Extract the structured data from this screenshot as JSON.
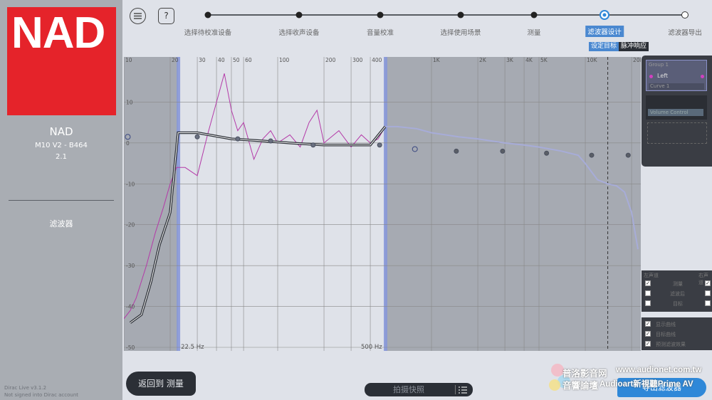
{
  "sidebar": {
    "logo_text": "NAD",
    "brand": "NAD",
    "model": "M10 V2 - B464",
    "channels": "2.1",
    "section": "滤波器",
    "version": "Dirac Live v3.1.2",
    "sign_status": "Not signed into Dirac account"
  },
  "header": {
    "menu_icon": "hamburger-icon",
    "help_label": "?"
  },
  "steps": [
    {
      "label": "选择待校准设备"
    },
    {
      "label": "选择收声设备"
    },
    {
      "label": "音量校准"
    },
    {
      "label": "选择使用场景"
    },
    {
      "label": "测量"
    },
    {
      "label": "滤波器设计",
      "active": true
    },
    {
      "label": "滤波器导出"
    }
  ],
  "subtabs": {
    "target": "设定目标",
    "impulse": "脉冲响应"
  },
  "chart_data": {
    "type": "line",
    "xscale": "log",
    "xlim": [
      10,
      22000
    ],
    "ylim": [
      -50,
      20
    ],
    "x_ticks": [
      {
        "v": 10,
        "l": "10"
      },
      {
        "v": 20,
        "l": "20"
      },
      {
        "v": 30,
        "l": "30"
      },
      {
        "v": 40,
        "l": "40"
      },
      {
        "v": 50,
        "l": "50"
      },
      {
        "v": 60,
        "l": "60"
      },
      {
        "v": 100,
        "l": "100"
      },
      {
        "v": 200,
        "l": "200"
      },
      {
        "v": 300,
        "l": "300"
      },
      {
        "v": 400,
        "l": "400"
      },
      {
        "v": 1000,
        "l": "1K"
      },
      {
        "v": 2000,
        "l": "2K"
      },
      {
        "v": 3000,
        "l": "3K"
      },
      {
        "v": 4000,
        "l": "4K"
      },
      {
        "v": 5000,
        "l": "5K"
      },
      {
        "v": 10000,
        "l": "10K"
      },
      {
        "v": 20000,
        "l": "20K"
      }
    ],
    "y_ticks": [
      10,
      0,
      -10,
      -20,
      -30,
      -40,
      -50
    ],
    "correction_range": {
      "low": 22.5,
      "high": 500,
      "low_label": "22.5 Hz",
      "high_label": "500 Hz"
    },
    "target_curve": {
      "x": [
        11,
        13,
        15,
        17,
        20,
        22.5,
        30,
        50,
        80,
        120,
        200,
        300,
        400,
        500
      ],
      "y": [
        -44,
        -42,
        -34,
        -25,
        -17,
        2.5,
        2.5,
        1,
        0.5,
        0,
        -0.5,
        -0.5,
        -0.5,
        4
      ]
    },
    "target_handles": [
      {
        "x": 10.6,
        "y": 1.5
      },
      {
        "x": 30,
        "y": 1.5
      },
      {
        "x": 55,
        "y": 1
      },
      {
        "x": 90,
        "y": 0.5
      },
      {
        "x": 170,
        "y": -0.5
      },
      {
        "x": 460,
        "y": -0.5
      },
      {
        "x": 780,
        "y": -1.5
      },
      {
        "x": 1450,
        "y": -2
      },
      {
        "x": 2900,
        "y": -2
      },
      {
        "x": 5600,
        "y": -2.5
      },
      {
        "x": 11000,
        "y": -3
      },
      {
        "x": 19000,
        "y": -3
      }
    ],
    "measured_curve": {
      "x": [
        10,
        11,
        12,
        14,
        16,
        18,
        20,
        22,
        25,
        30,
        35,
        40,
        45,
        50,
        55,
        60,
        70,
        80,
        90,
        100,
        120,
        140,
        160,
        180,
        200,
        250,
        300,
        350,
        400,
        450,
        500
      ],
      "y": [
        -43,
        -41,
        -38,
        -30,
        -22,
        -16,
        -10,
        -6,
        -6,
        -8,
        2,
        10,
        17,
        8,
        3,
        5,
        -4,
        1,
        3,
        0,
        2,
        -1,
        5,
        8,
        0,
        3,
        -1,
        2,
        0,
        1,
        4
      ]
    },
    "predicted_response": {
      "x": [
        500,
        600,
        800,
        1000,
        1500,
        2000,
        3000,
        4000,
        5000,
        7000,
        9000,
        10000,
        12000,
        14000,
        16000,
        18000,
        20000,
        22000
      ],
      "y": [
        4,
        4,
        3.5,
        2.5,
        1.5,
        1,
        0,
        -0.5,
        -1,
        -2,
        -3,
        -5,
        -9,
        -10,
        -10.5,
        -12,
        -17,
        -26
      ]
    },
    "cutoff_line_x": 14000
  },
  "filter_panel": {
    "group": "Group 1",
    "channel": "Left",
    "curve_label": "Curve 1",
    "input_value": "Volume Control"
  },
  "options": {
    "col1": "左声道",
    "col2": "右声道",
    "rows": [
      "测量",
      "滤波后",
      "目标"
    ],
    "extra": [
      "显示曲线",
      "目标曲线",
      "预测滤波效果"
    ]
  },
  "buttons": {
    "back": "返回到 测量",
    "snapshot": "拍摄快照",
    "next": "导出滤波器"
  },
  "watermark": {
    "line1": "普洛影音网",
    "line2": "音響論壇",
    "url1": "www.audionet.com.tw",
    "url2": "Audioart新視聽Prime AV"
  },
  "colors": {
    "accent": "#2f88d8",
    "logo": "#e5232a",
    "band": "#8898d8",
    "measured": "#b43aa8",
    "predicted": "#a7acd8"
  }
}
